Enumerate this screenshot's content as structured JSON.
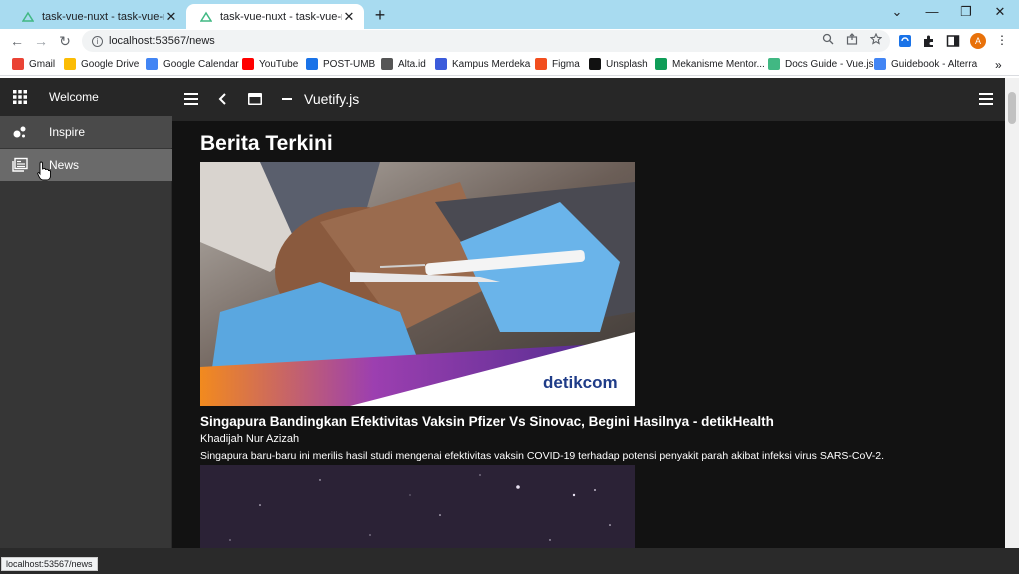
{
  "browser": {
    "tabs": [
      {
        "title": "task-vue-nuxt - task-vue-nuxt",
        "close": "✕"
      },
      {
        "title": "task-vue-nuxt - task-vue-nuxt",
        "close": "✕"
      }
    ],
    "new_tab": "+",
    "window_controls": {
      "collapse": "⌄",
      "minimize": "—",
      "restore": "❐",
      "close": "✕"
    },
    "nav": {
      "back": "←",
      "forward": "→",
      "reload": "↻"
    },
    "url": "localhost:53567/news",
    "profile_initial": "A",
    "menu": "⋮",
    "status_url": "localhost:53567/news"
  },
  "bookmarks": [
    {
      "label": "Gmail",
      "color": "#ea4335"
    },
    {
      "label": "Google Drive",
      "color": "#fbbc04"
    },
    {
      "label": "Google Calendar",
      "color": "#4285f4"
    },
    {
      "label": "YouTube",
      "color": "#ff0000"
    },
    {
      "label": "POST-UMB",
      "color": "#1a73e8"
    },
    {
      "label": "Alta.id",
      "color": "#555555"
    },
    {
      "label": "Kampus Merdeka",
      "color": "#3b5bdb"
    },
    {
      "label": "Figma",
      "color": "#f24e1e"
    },
    {
      "label": "Unsplash",
      "color": "#111111"
    },
    {
      "label": "Mekanisme Mentor...",
      "color": "#0f9d58"
    },
    {
      "label": "Docs Guide - Vue.js",
      "color": "#41b883"
    },
    {
      "label": "Guidebook - Alterra",
      "color": "#4285f4"
    }
  ],
  "bookmarks_overflow": "»",
  "drawer": {
    "header": "Welcome",
    "items": [
      {
        "label": "Inspire"
      },
      {
        "label": "News"
      }
    ]
  },
  "appbar": {
    "title": "Vuetify.js"
  },
  "main": {
    "page_title": "Berita Terkini",
    "articles": [
      {
        "headline": "Singapura Bandingkan Efektivitas Vaksin Pfizer Vs Sinovac, Begini Hasilnya - detikHealth",
        "author": "Khadijah Nur Azizah",
        "description": "Singapura baru-baru ini merilis hasil studi mengenai efektivitas vaksin COVID-19 terhadap potensi penyakit parah akibat infeksi virus SARS-CoV-2.",
        "image_watermark": "detikcom"
      }
    ]
  },
  "colors": {
    "tab_strip": "#a8dbf0",
    "app_bg": "#121212",
    "drawer_bg": "#363636",
    "appbar_bg": "#272727",
    "news_active": "#6a6a6a"
  }
}
